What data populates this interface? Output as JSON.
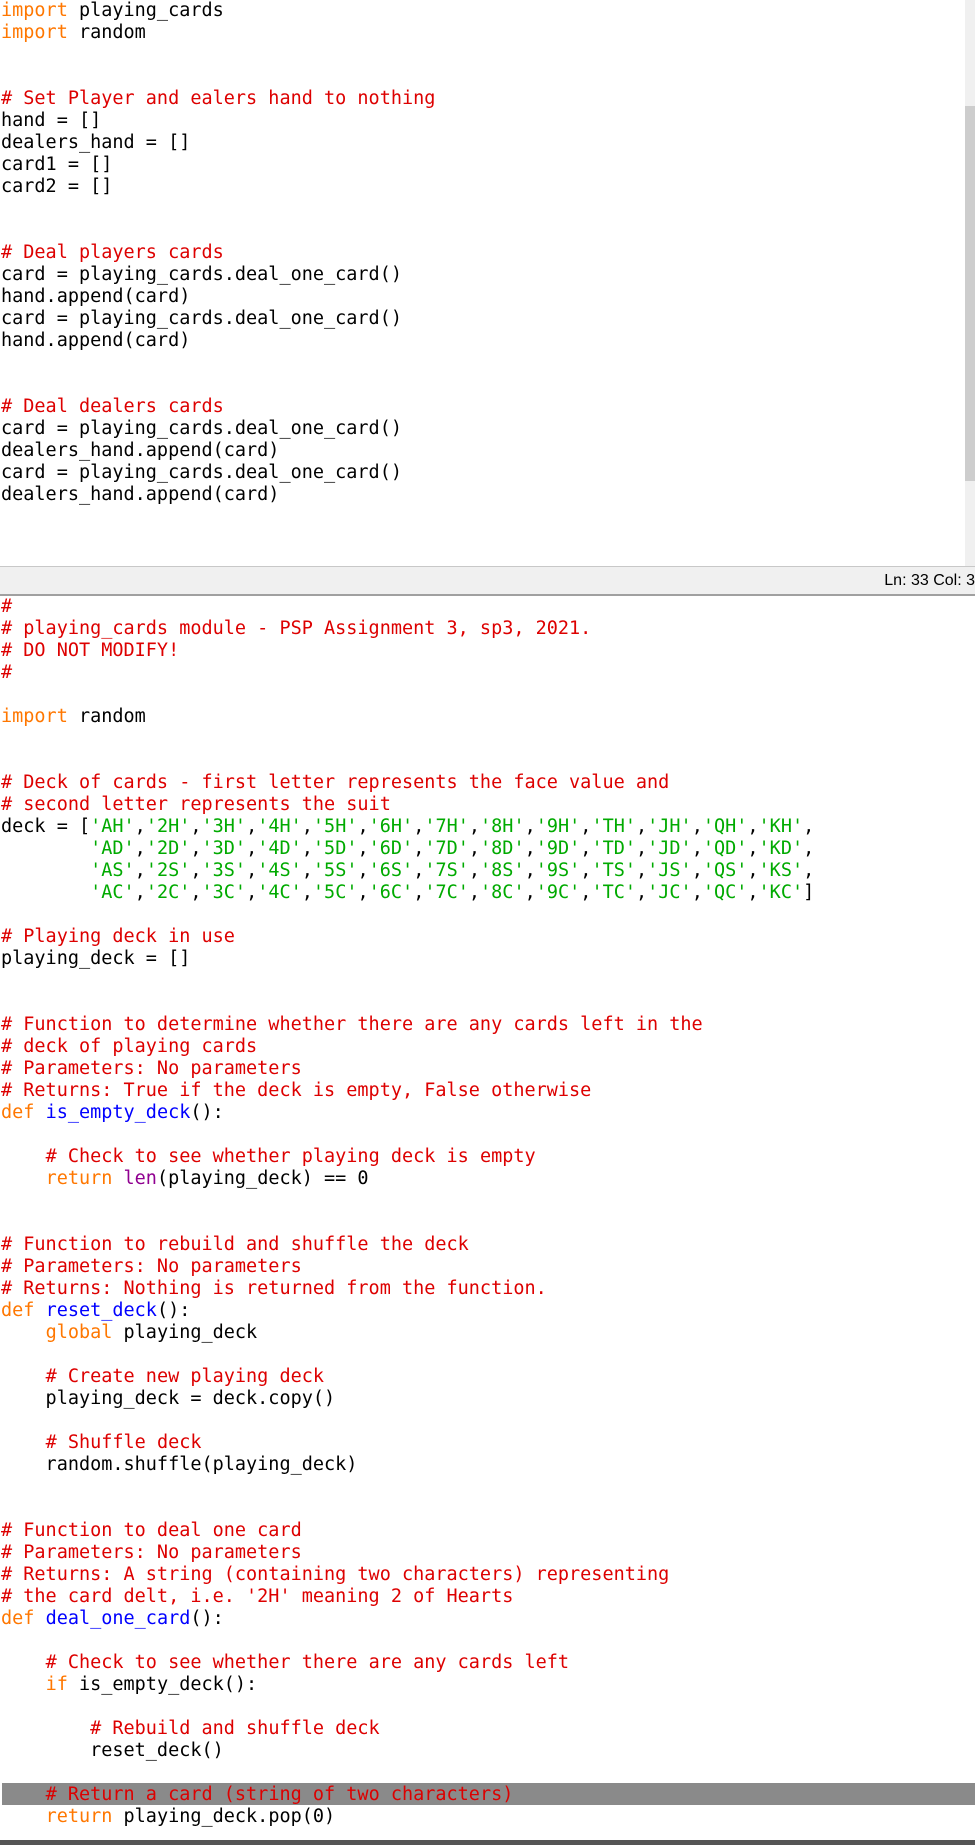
{
  "editor_top": {
    "lines": [
      [
        [
          "kw",
          "import"
        ],
        [
          "t",
          " playing_cards"
        ]
      ],
      [
        [
          "kw",
          "import"
        ],
        [
          "t",
          " random"
        ]
      ],
      [],
      [],
      [
        [
          "cm",
          "# Set Player and ealers hand to nothing"
        ]
      ],
      [
        [
          "t",
          "hand = []"
        ]
      ],
      [
        [
          "t",
          "dealers_hand = []"
        ]
      ],
      [
        [
          "t",
          "card1 = []"
        ]
      ],
      [
        [
          "t",
          "card2 = []"
        ]
      ],
      [],
      [],
      [
        [
          "cm",
          "# Deal players cards"
        ]
      ],
      [
        [
          "t",
          "card = playing_cards.deal_one_card()"
        ]
      ],
      [
        [
          "t",
          "hand.append(card)"
        ]
      ],
      [
        [
          "t",
          "card = playing_cards.deal_one_card()"
        ]
      ],
      [
        [
          "t",
          "hand.append(card)"
        ]
      ],
      [],
      [],
      [
        [
          "cm",
          "# Deal dealers cards"
        ]
      ],
      [
        [
          "t",
          "card = playing_cards.deal_one_card()"
        ]
      ],
      [
        [
          "t",
          "dealers_hand.append(card)"
        ]
      ],
      [
        [
          "t",
          "card = playing_cards.deal_one_card()"
        ]
      ],
      [
        [
          "t",
          "dealers_hand.append(card)"
        ]
      ]
    ]
  },
  "status_bar": {
    "text": "Ln: 33   Col: 3"
  },
  "editor_bottom": {
    "lines": [
      [
        [
          "cm",
          "#"
        ]
      ],
      [
        [
          "cm",
          "# playing_cards module - PSP Assignment 3, sp3, 2021."
        ]
      ],
      [
        [
          "cm",
          "# DO NOT MODIFY!"
        ]
      ],
      [
        [
          "cm",
          "#"
        ]
      ],
      [],
      [
        [
          "kw",
          "import"
        ],
        [
          "t",
          " random"
        ]
      ],
      [],
      [],
      [
        [
          "cm",
          "# Deck of cards - first letter represents the face value and"
        ]
      ],
      [
        [
          "cm",
          "# second letter represents the suit"
        ]
      ],
      [
        [
          "t",
          "deck = ["
        ],
        [
          "st",
          "'AH'"
        ],
        [
          "t",
          ","
        ],
        [
          "st",
          "'2H'"
        ],
        [
          "t",
          ","
        ],
        [
          "st",
          "'3H'"
        ],
        [
          "t",
          ","
        ],
        [
          "st",
          "'4H'"
        ],
        [
          "t",
          ","
        ],
        [
          "st",
          "'5H'"
        ],
        [
          "t",
          ","
        ],
        [
          "st",
          "'6H'"
        ],
        [
          "t",
          ","
        ],
        [
          "st",
          "'7H'"
        ],
        [
          "t",
          ","
        ],
        [
          "st",
          "'8H'"
        ],
        [
          "t",
          ","
        ],
        [
          "st",
          "'9H'"
        ],
        [
          "t",
          ","
        ],
        [
          "st",
          "'TH'"
        ],
        [
          "t",
          ","
        ],
        [
          "st",
          "'JH'"
        ],
        [
          "t",
          ","
        ],
        [
          "st",
          "'QH'"
        ],
        [
          "t",
          ","
        ],
        [
          "st",
          "'KH'"
        ],
        [
          "t",
          ","
        ]
      ],
      [
        [
          "t",
          "        "
        ],
        [
          "st",
          "'AD'"
        ],
        [
          "t",
          ","
        ],
        [
          "st",
          "'2D'"
        ],
        [
          "t",
          ","
        ],
        [
          "st",
          "'3D'"
        ],
        [
          "t",
          ","
        ],
        [
          "st",
          "'4D'"
        ],
        [
          "t",
          ","
        ],
        [
          "st",
          "'5D'"
        ],
        [
          "t",
          ","
        ],
        [
          "st",
          "'6D'"
        ],
        [
          "t",
          ","
        ],
        [
          "st",
          "'7D'"
        ],
        [
          "t",
          ","
        ],
        [
          "st",
          "'8D'"
        ],
        [
          "t",
          ","
        ],
        [
          "st",
          "'9D'"
        ],
        [
          "t",
          ","
        ],
        [
          "st",
          "'TD'"
        ],
        [
          "t",
          ","
        ],
        [
          "st",
          "'JD'"
        ],
        [
          "t",
          ","
        ],
        [
          "st",
          "'QD'"
        ],
        [
          "t",
          ","
        ],
        [
          "st",
          "'KD'"
        ],
        [
          "t",
          ","
        ]
      ],
      [
        [
          "t",
          "        "
        ],
        [
          "st",
          "'AS'"
        ],
        [
          "t",
          ","
        ],
        [
          "st",
          "'2S'"
        ],
        [
          "t",
          ","
        ],
        [
          "st",
          "'3S'"
        ],
        [
          "t",
          ","
        ],
        [
          "st",
          "'4S'"
        ],
        [
          "t",
          ","
        ],
        [
          "st",
          "'5S'"
        ],
        [
          "t",
          ","
        ],
        [
          "st",
          "'6S'"
        ],
        [
          "t",
          ","
        ],
        [
          "st",
          "'7S'"
        ],
        [
          "t",
          ","
        ],
        [
          "st",
          "'8S'"
        ],
        [
          "t",
          ","
        ],
        [
          "st",
          "'9S'"
        ],
        [
          "t",
          ","
        ],
        [
          "st",
          "'TS'"
        ],
        [
          "t",
          ","
        ],
        [
          "st",
          "'JS'"
        ],
        [
          "t",
          ","
        ],
        [
          "st",
          "'QS'"
        ],
        [
          "t",
          ","
        ],
        [
          "st",
          "'KS'"
        ],
        [
          "t",
          ","
        ]
      ],
      [
        [
          "t",
          "        "
        ],
        [
          "st",
          "'AC'"
        ],
        [
          "t",
          ","
        ],
        [
          "st",
          "'2C'"
        ],
        [
          "t",
          ","
        ],
        [
          "st",
          "'3C'"
        ],
        [
          "t",
          ","
        ],
        [
          "st",
          "'4C'"
        ],
        [
          "t",
          ","
        ],
        [
          "st",
          "'5C'"
        ],
        [
          "t",
          ","
        ],
        [
          "st",
          "'6C'"
        ],
        [
          "t",
          ","
        ],
        [
          "st",
          "'7C'"
        ],
        [
          "t",
          ","
        ],
        [
          "st",
          "'8C'"
        ],
        [
          "t",
          ","
        ],
        [
          "st",
          "'9C'"
        ],
        [
          "t",
          ","
        ],
        [
          "st",
          "'TC'"
        ],
        [
          "t",
          ","
        ],
        [
          "st",
          "'JC'"
        ],
        [
          "t",
          ","
        ],
        [
          "st",
          "'QC'"
        ],
        [
          "t",
          ","
        ],
        [
          "st",
          "'KC'"
        ],
        [
          "t",
          "]"
        ]
      ],
      [],
      [
        [
          "cm",
          "# Playing deck in use"
        ]
      ],
      [
        [
          "t",
          "playing_deck = []"
        ]
      ],
      [],
      [],
      [
        [
          "cm",
          "# Function to determine whether there are any cards left in the"
        ]
      ],
      [
        [
          "cm",
          "# deck of playing cards"
        ]
      ],
      [
        [
          "cm",
          "# Parameters: No parameters"
        ]
      ],
      [
        [
          "cm",
          "# Returns: True if the deck is empty, False otherwise"
        ]
      ],
      [
        [
          "kw",
          "def"
        ],
        [
          "t",
          " "
        ],
        [
          "fn",
          "is_empty_deck"
        ],
        [
          "t",
          "():"
        ]
      ],
      [],
      [
        [
          "t",
          "    "
        ],
        [
          "cm",
          "# Check to see whether playing deck is empty"
        ]
      ],
      [
        [
          "t",
          "    "
        ],
        [
          "kw",
          "return"
        ],
        [
          "t",
          " "
        ],
        [
          "bi",
          "len"
        ],
        [
          "t",
          "(playing_deck) == 0"
        ]
      ],
      [],
      [],
      [
        [
          "cm",
          "# Function to rebuild and shuffle the deck"
        ]
      ],
      [
        [
          "cm",
          "# Parameters: No parameters"
        ]
      ],
      [
        [
          "cm",
          "# Returns: Nothing is returned from the function."
        ]
      ],
      [
        [
          "kw",
          "def"
        ],
        [
          "t",
          " "
        ],
        [
          "fn",
          "reset_deck"
        ],
        [
          "t",
          "():"
        ]
      ],
      [
        [
          "t",
          "    "
        ],
        [
          "kw",
          "global"
        ],
        [
          "t",
          " playing_deck"
        ]
      ],
      [],
      [
        [
          "t",
          "    "
        ],
        [
          "cm",
          "# Create new playing deck"
        ]
      ],
      [
        [
          "t",
          "    playing_deck = deck.copy()"
        ]
      ],
      [],
      [
        [
          "t",
          "    "
        ],
        [
          "cm",
          "# Shuffle deck"
        ]
      ],
      [
        [
          "t",
          "    random.shuffle(playing_deck)"
        ]
      ],
      [],
      [],
      [
        [
          "cm",
          "# Function to deal one card"
        ]
      ],
      [
        [
          "cm",
          "# Parameters: No parameters"
        ]
      ],
      [
        [
          "cm",
          "# Returns: A string (containing two characters) representing"
        ]
      ],
      [
        [
          "cm",
          "# the card delt, i.e. '2H' meaning 2 of Hearts"
        ]
      ],
      [
        [
          "kw",
          "def"
        ],
        [
          "t",
          " "
        ],
        [
          "fn",
          "deal_one_card"
        ],
        [
          "t",
          "():"
        ]
      ],
      [],
      [
        [
          "t",
          "    "
        ],
        [
          "cm",
          "# Check to see whether there are any cards left"
        ]
      ],
      [
        [
          "t",
          "    "
        ],
        [
          "kw",
          "if"
        ],
        [
          "t",
          " is_empty_deck():"
        ]
      ],
      [],
      [
        [
          "t",
          "        "
        ],
        [
          "cm",
          "# Rebuild and shuffle deck"
        ]
      ],
      [
        [
          "t",
          "        reset_deck()"
        ]
      ],
      [],
      [
        [
          "t",
          "    "
        ],
        [
          "cm",
          "# Return a card (string of two characters)"
        ]
      ],
      [
        [
          "t",
          "    "
        ],
        [
          "kw",
          "return"
        ],
        [
          "t",
          " playing_deck.pop(0)"
        ]
      ]
    ]
  },
  "colors": {
    "keyword": "#ff7700",
    "comment": "#dd0000",
    "string": "#00aa00",
    "function_name": "#0000ff",
    "builtin": "#900090"
  }
}
